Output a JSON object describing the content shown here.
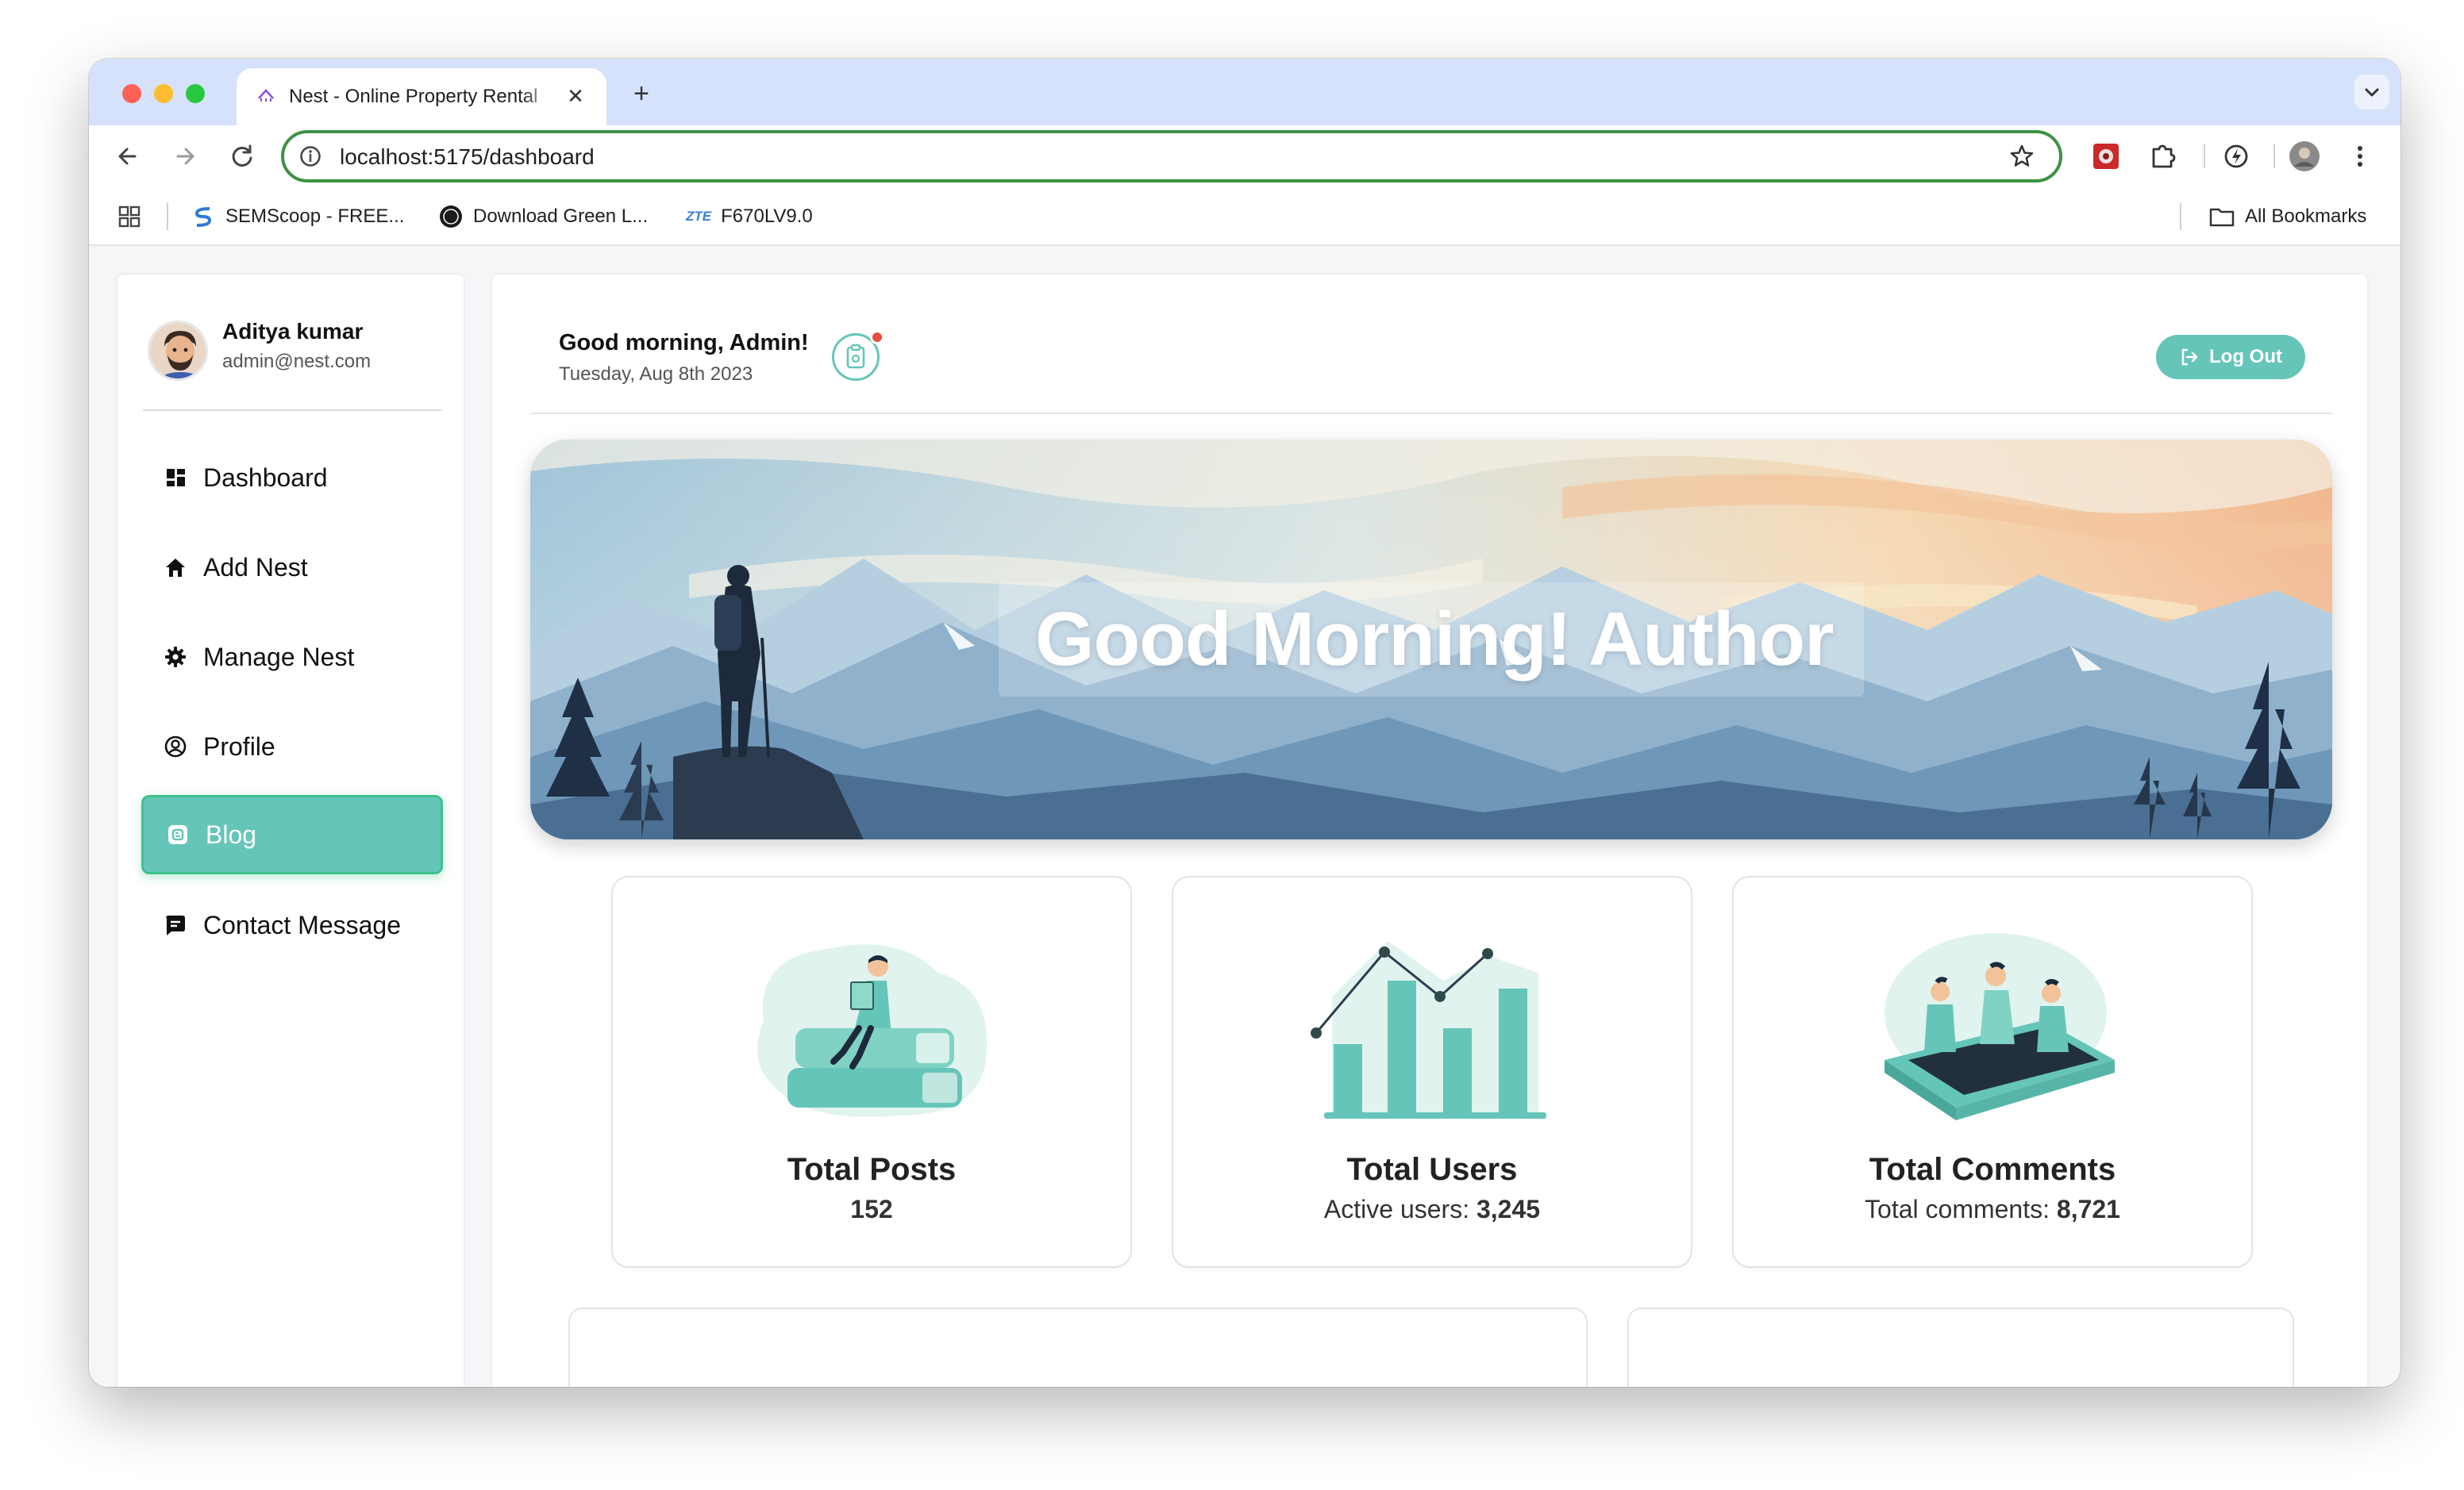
{
  "browser": {
    "tab_title": "Nest - Online Property Rental",
    "tab_close": "✕",
    "new_tab": "+",
    "url": "localhost:5175/dashboard",
    "bookmarks": [
      {
        "label": "SEMScoop - FREE...",
        "icon": "semscoop-icon"
      },
      {
        "label": "Download Green L...",
        "icon": "pro-badge-icon"
      },
      {
        "label": "F670LV9.0",
        "icon": "zte-icon",
        "icon_text": "ZTE"
      }
    ],
    "all_bookmarks": "All Bookmarks"
  },
  "user": {
    "name": "Aditya kumar",
    "email": "admin@nest.com"
  },
  "menu": [
    {
      "label": "Dashboard",
      "icon": "dashboard-icon",
      "active": false
    },
    {
      "label": "Add Nest",
      "icon": "home-icon",
      "active": false
    },
    {
      "label": "Manage Nest",
      "icon": "gear-icon",
      "active": false
    },
    {
      "label": "Profile",
      "icon": "user-circle-icon",
      "active": false
    },
    {
      "label": "Blog",
      "icon": "blog-icon",
      "active": true
    },
    {
      "label": "Contact Message",
      "icon": "message-icon",
      "active": false
    }
  ],
  "header": {
    "greeting": "Good morning, Admin!",
    "date": "Tuesday, Aug 8th 2023",
    "logout": "Log Out"
  },
  "hero": {
    "text": "Good Morning! Author"
  },
  "stats": [
    {
      "title": "Total Posts",
      "prefix": "",
      "value": "152",
      "illustration": "books-reader-illustration"
    },
    {
      "title": "Total Users",
      "prefix": "Active users: ",
      "value": "3,245",
      "illustration": "bar-chart-illustration"
    },
    {
      "title": "Total Comments",
      "prefix": "Total comments: ",
      "value": "8,721",
      "illustration": "group-discussion-illustration"
    }
  ],
  "colors": {
    "accent": "#65c5b8",
    "accent_border": "#3ec28b",
    "omnibox_border": "#3d9243",
    "notification": "#e84d3d"
  }
}
